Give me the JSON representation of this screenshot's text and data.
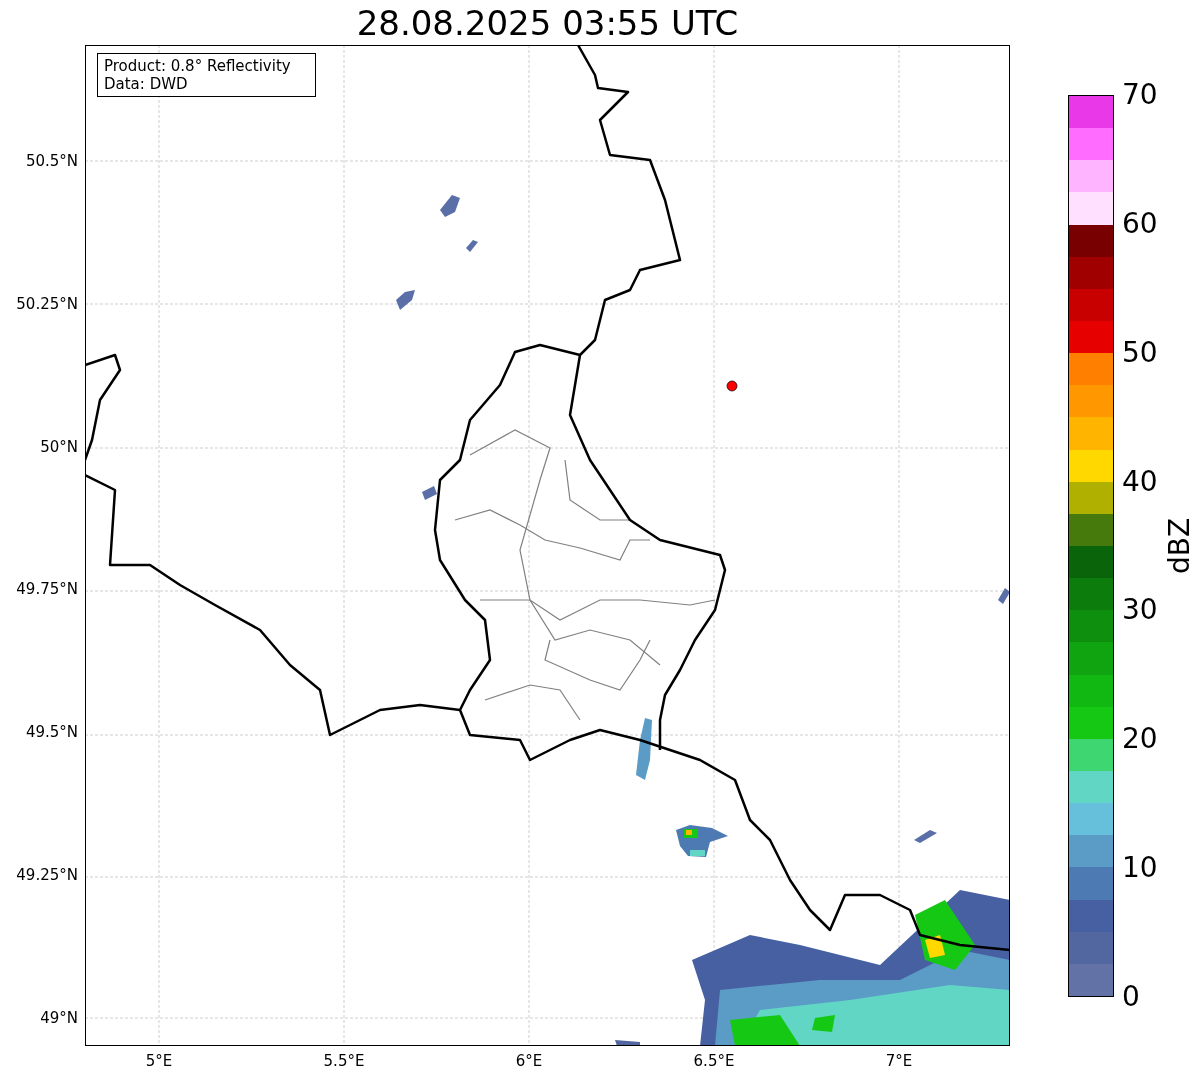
{
  "title": "28.08.2025 03:55 UTC",
  "info_box": [
    "Product: 0.8° Reflectivity",
    "Data: DWD"
  ],
  "map": {
    "xticks": [
      "5°E",
      "5.5°E",
      "6°E",
      "6.5°E",
      "7°E"
    ],
    "yticks": [
      "50.5°N",
      "50.25°N",
      "50°N",
      "49.75°N",
      "49.5°N",
      "49.25°N",
      "49°N"
    ]
  },
  "colorbar": {
    "label": "dBZ",
    "ticks": [
      "70",
      "60",
      "50",
      "40",
      "30",
      "20",
      "10",
      "0"
    ],
    "segments": [
      {
        "color": "#e838e8"
      },
      {
        "color": "#ff6cff"
      },
      {
        "color": "#ffb4ff"
      },
      {
        "color": "#ffe0ff"
      },
      {
        "color": "#780000"
      },
      {
        "color": "#a00000"
      },
      {
        "color": "#c80000"
      },
      {
        "color": "#e60000"
      },
      {
        "color": "#ff8000"
      },
      {
        "color": "#ff9800"
      },
      {
        "color": "#ffb400"
      },
      {
        "color": "#ffd800"
      },
      {
        "color": "#b0b000"
      },
      {
        "color": "#467a0c"
      },
      {
        "color": "#0a640a"
      },
      {
        "color": "#0c7c0c"
      },
      {
        "color": "#0e900e"
      },
      {
        "color": "#10a410"
      },
      {
        "color": "#12b812"
      },
      {
        "color": "#14c814"
      },
      {
        "color": "#3ed670"
      },
      {
        "color": "#62d6c4"
      },
      {
        "color": "#66c0dc"
      },
      {
        "color": "#5a9cc6"
      },
      {
        "color": "#4e7ab4"
      },
      {
        "color": "#4660a2"
      },
      {
        "color": "#5266a0"
      },
      {
        "color": "#6272a6"
      }
    ]
  }
}
